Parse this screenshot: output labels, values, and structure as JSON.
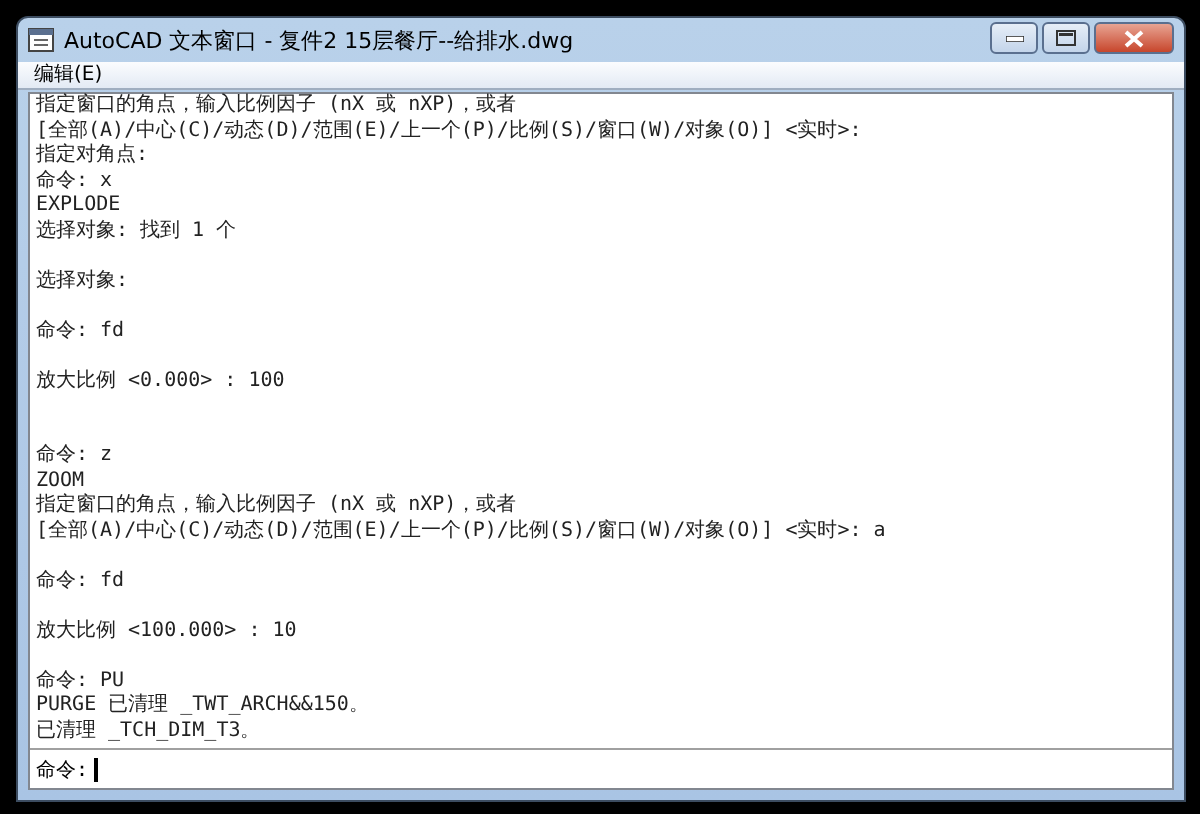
{
  "window": {
    "title": "AutoCAD 文本窗口 - 复件2 15层餐厅--给排水.dwg"
  },
  "menu": [
    {
      "label": "编辑(E)"
    }
  ],
  "log": [
    {
      "kind": "text",
      "text": "指定窗口的角点，输入比例因子 (nX 或 nXP)，或者"
    },
    {
      "kind": "text",
      "text": "[全部(A)/中心(C)/动态(D)/范围(E)/上一个(P)/比例(S)/窗口(W)/对象(O)] <实时>:"
    },
    {
      "kind": "text",
      "text": "指定对角点:"
    },
    {
      "kind": "text",
      "text": "命令: x"
    },
    {
      "kind": "text",
      "text": "EXPLODE"
    },
    {
      "kind": "text",
      "text": "选择对象: 找到 1 个"
    },
    {
      "kind": "blank"
    },
    {
      "kind": "text",
      "text": "选择对象:"
    },
    {
      "kind": "blank"
    },
    {
      "kind": "text",
      "text": "命令: fd"
    },
    {
      "kind": "blank"
    },
    {
      "kind": "text",
      "text": "放大比例 <0.000> : 100"
    },
    {
      "kind": "blank"
    },
    {
      "kind": "blank"
    },
    {
      "kind": "text",
      "text": "命令: z"
    },
    {
      "kind": "text",
      "text": "ZOOM"
    },
    {
      "kind": "text",
      "text": "指定窗口的角点，输入比例因子 (nX 或 nXP)，或者"
    },
    {
      "kind": "text",
      "text": "[全部(A)/中心(C)/动态(D)/范围(E)/上一个(P)/比例(S)/窗口(W)/对象(O)] <实时>: a"
    },
    {
      "kind": "blank"
    },
    {
      "kind": "text",
      "text": "命令: fd"
    },
    {
      "kind": "blank"
    },
    {
      "kind": "text",
      "text": "放大比例 <100.000> : 10"
    },
    {
      "kind": "blank"
    },
    {
      "kind": "text",
      "text": "命令: PU"
    },
    {
      "kind": "text",
      "text": "PURGE 已清理 _TWT_ARCH&&150。"
    },
    {
      "kind": "text",
      "text": "已清理 _TCH_DIM_T3。"
    }
  ],
  "command_line": {
    "prompt": "命令:"
  }
}
